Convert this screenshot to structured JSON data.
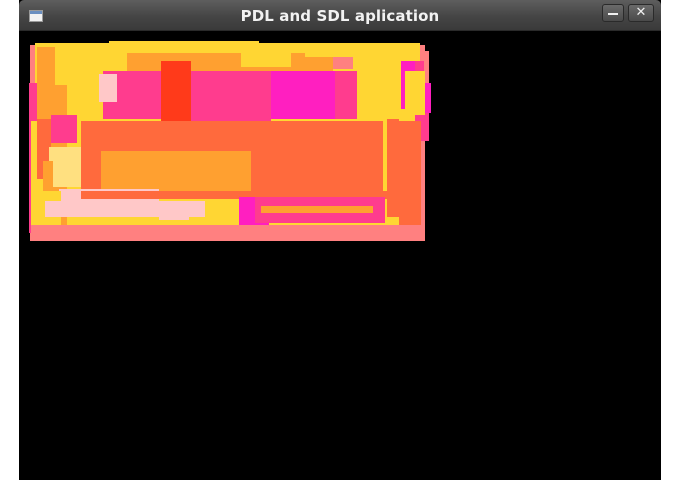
{
  "window": {
    "title": "PDL and SDL aplication",
    "icon": "window-app-icon",
    "minimize_icon": "minimize-icon",
    "close_icon": "close-icon",
    "background": "#000000"
  },
  "canvas": {
    "palette": [
      "#FFD633",
      "#FF6A3D",
      "#FF3C8E",
      "#FF1FC0",
      "#FF8080",
      "#FFC8C8",
      "#FF3A1A",
      "#FFA030",
      "#FFE080"
    ]
  }
}
